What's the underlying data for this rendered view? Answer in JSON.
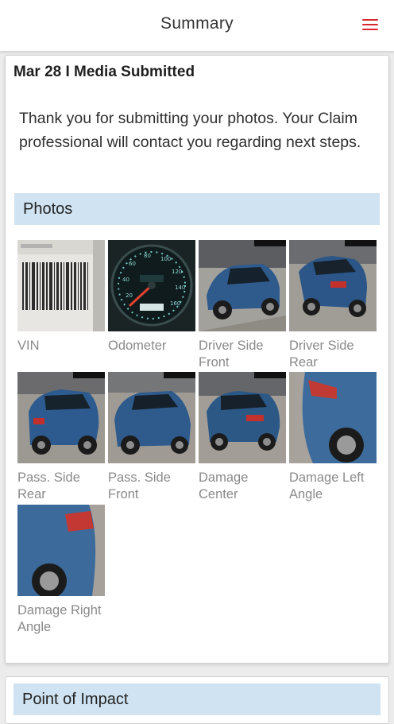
{
  "header": {
    "title": "Summary",
    "menu_icon": "hamburger-menu-icon",
    "accent_color": "#d9262c"
  },
  "summary_card": {
    "heading": "Mar 28 I Media Submitted",
    "message": "Thank you for submitting your photos. Your Claim professional will contact you regarding next steps.",
    "photos_section": {
      "label": "Photos",
      "band_color": "#cfe3f2",
      "items": [
        {
          "caption": "VIN"
        },
        {
          "caption": "Odometer"
        },
        {
          "caption": "Driver Side Front"
        },
        {
          "caption": "Driver Side Rear"
        },
        {
          "caption": "Pass. Side Rear"
        },
        {
          "caption": "Pass. Side Front"
        },
        {
          "caption": "Damage Center"
        },
        {
          "caption": "Damage Left Angle"
        },
        {
          "caption": "Damage Right Angle"
        }
      ]
    }
  },
  "impact_card": {
    "label": "Point of Impact"
  }
}
